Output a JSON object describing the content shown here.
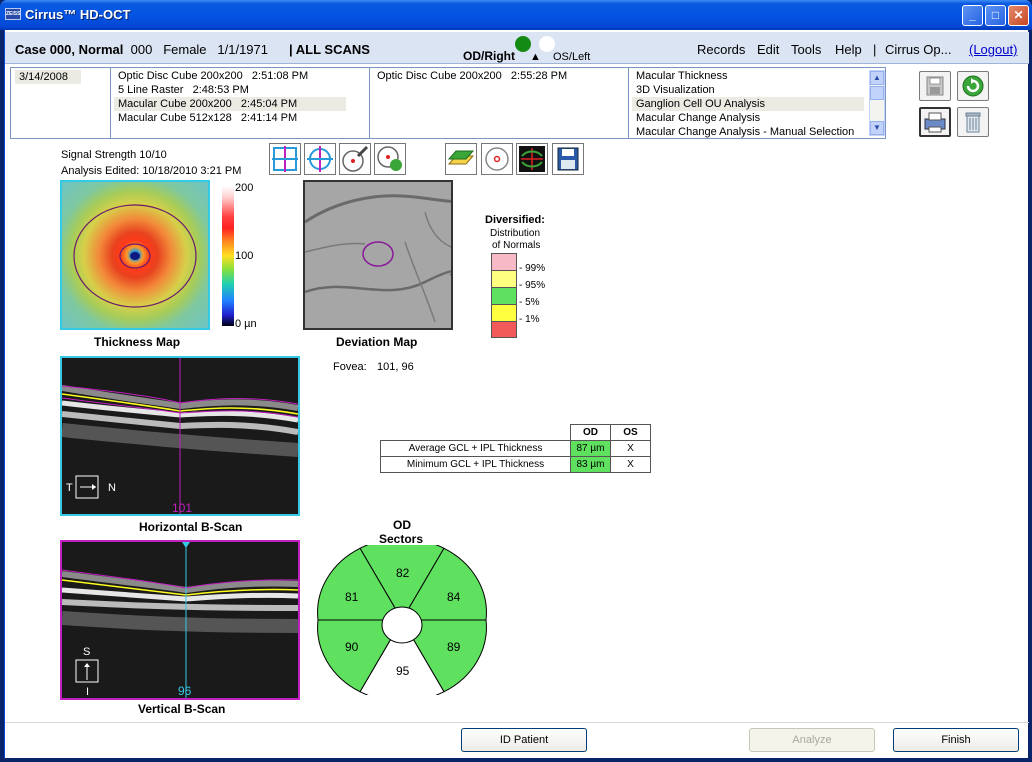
{
  "window": {
    "title": "Cirrus™ HD-OCT",
    "logo_text": "ZEISS"
  },
  "casebar": {
    "patient_name": "Case 000, Normal",
    "patient_id": "000",
    "sex": "Female",
    "dob": "1/1/1971",
    "scans_label": "| ALL SCANS",
    "od_label": "OD/Right",
    "os_label": "OS/Left",
    "eye_arrow": "▲",
    "menu": [
      "Records",
      "Edit",
      "Tools",
      "Help",
      "|",
      "Cirrus Op..."
    ],
    "logout": "(Logout)",
    "od_color": "#138a13",
    "os_color": "#ffffff"
  },
  "scanlist": {
    "date": "3/14/2008",
    "col1": [
      {
        "name": "Optic Disc Cube 200x200",
        "time": "2:51:08 PM"
      },
      {
        "name": "5 Line Raster",
        "time": "2:48:53 PM"
      },
      {
        "name": "Macular Cube 200x200",
        "time": "2:45:04 PM"
      },
      {
        "name": "Macular Cube 512x128",
        "time": "2:41:14 PM"
      }
    ],
    "col2": [
      {
        "name": "Optic Disc Cube 200x200",
        "time": "2:55:28 PM"
      }
    ],
    "analyses": [
      "Macular Thickness",
      "3D Visualization",
      "Ganglion Cell OU Analysis",
      "Macular Change Analysis",
      "Macular Change Analysis - Manual Selection"
    ]
  },
  "analysis": {
    "signal_strength": "Signal Strength  10/10",
    "analysis_edited": "Analysis Edited: 10/18/2010 3:21 PM",
    "thickness_caption": "Thickness Map",
    "deviation_caption": "Deviation Map",
    "scale_max": "200",
    "scale_mid": "100",
    "scale_min": "0 µn",
    "fovea_label": "Fovea:",
    "fovea_value": "101, 96",
    "legend_title": "Diversified:",
    "legend_sub1": "Distribution",
    "legend_sub2": "of Normals",
    "legend_levels": [
      "99%",
      "95%",
      "5%",
      "1%"
    ],
    "legend_colors": [
      "#f7b9c6",
      "#ffff80",
      "#5fe05f",
      "#ffff40",
      "#f25a5a"
    ],
    "hscan_caption": "Horizontal B-Scan",
    "vscan_caption": "Vertical B-Scan",
    "hscan_index": "101",
    "vscan_index": "96",
    "hscan_orient": {
      "left": "T",
      "right": "N"
    },
    "vscan_orient": {
      "top": "S",
      "bottom": "I"
    }
  },
  "table": {
    "headers": [
      "",
      "OD",
      "OS"
    ],
    "rows": [
      {
        "name": "Average GCL + IPL Thickness",
        "od": "87 µm",
        "os": "X"
      },
      {
        "name": "Minimum GCL + IPL Thickness",
        "od": "83 µm",
        "os": "X"
      }
    ]
  },
  "sectors": {
    "title1": "OD",
    "title2": "Sectors",
    "values": {
      "top": "82",
      "top_right": "84",
      "bottom_right": "89",
      "bottom": "95",
      "bottom_left": "90",
      "top_left": "81"
    },
    "fill_normal": "#5fe05f",
    "fill_white": "#ffffff"
  },
  "buttons": {
    "id_patient": "ID Patient",
    "analyze": "Analyze",
    "finish": "Finish"
  }
}
